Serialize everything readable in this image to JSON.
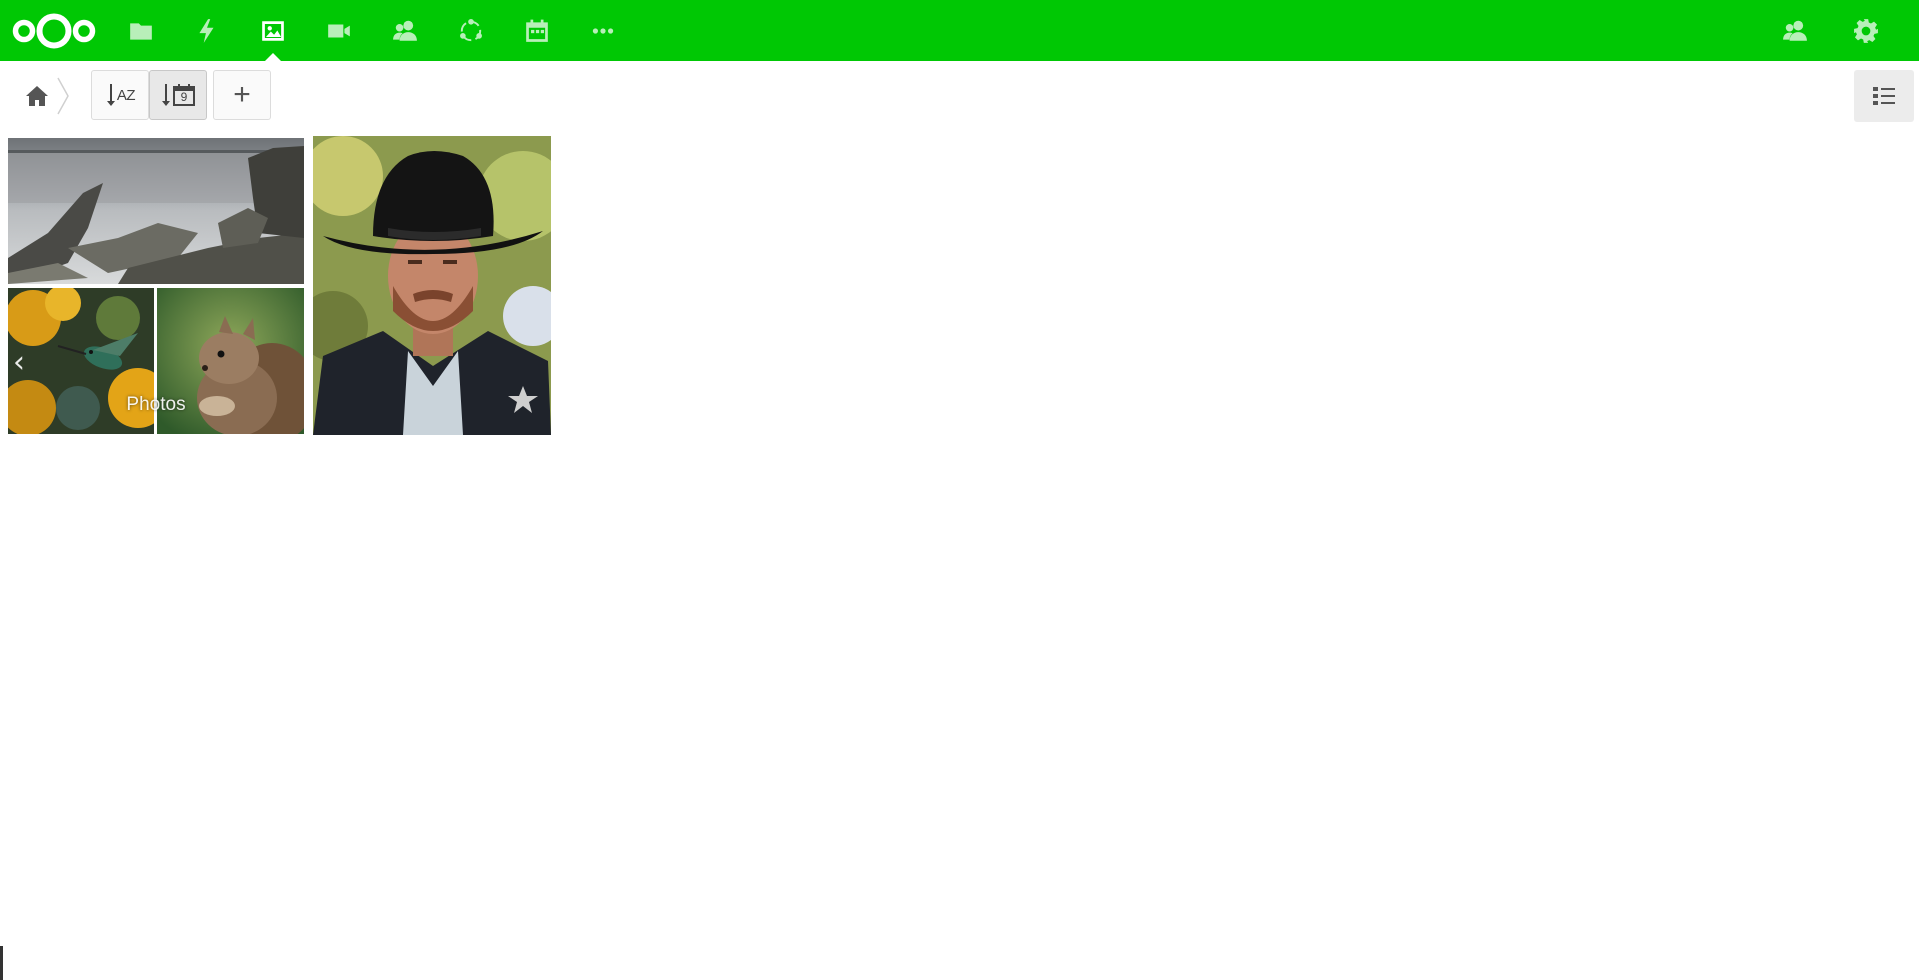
{
  "header": {
    "logo": "nextcloud-logo",
    "apps": [
      {
        "name": "files",
        "icon": "folder-icon",
        "active": false
      },
      {
        "name": "activity",
        "icon": "lightning-icon",
        "active": false
      },
      {
        "name": "gallery",
        "icon": "image-icon",
        "active": true
      },
      {
        "name": "talk",
        "icon": "video-icon",
        "active": false
      },
      {
        "name": "contacts",
        "icon": "contacts-icon",
        "active": false
      },
      {
        "name": "circles",
        "icon": "circles-icon",
        "active": false
      },
      {
        "name": "calendar",
        "icon": "calendar-icon",
        "active": false
      },
      {
        "name": "more",
        "icon": "more-icon",
        "active": false
      }
    ],
    "right": [
      {
        "name": "contacts-menu",
        "icon": "contacts-icon"
      },
      {
        "name": "settings-menu",
        "icon": "gear-icon"
      }
    ],
    "color": "#00c804"
  },
  "controls": {
    "breadcrumb_home": "home-icon",
    "sort_name_label": "AZ",
    "sort_date_label": "9",
    "add_button": "+",
    "view_toggle": "list-icon"
  },
  "gallery": {
    "album": {
      "label": "Photos",
      "tiles": [
        "rocky-coast",
        "hummingbird",
        "squirrel"
      ]
    },
    "photos": [
      "cowboy-portrait"
    ]
  }
}
